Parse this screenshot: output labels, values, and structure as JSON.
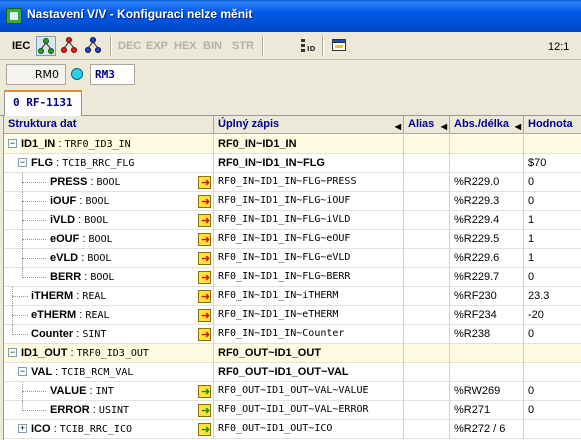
{
  "window": {
    "title": "Nastavení V/V - Konfiguraci nelze měnit"
  },
  "toolbar": {
    "iec_label": "IEC",
    "dec_label": "DEC",
    "exp_label": "EXP",
    "hex_label": "HEX",
    "bin_label": "BIN",
    "str_label": "STR",
    "clock": "12:1"
  },
  "rm": {
    "rm0_label": "RM0",
    "rm3_label": "RM3",
    "indicator_color": "#22d5e8"
  },
  "tab": {
    "label": "0 RF-1131"
  },
  "grid": {
    "headers": {
      "struktura": "Struktura dat",
      "uplny": "Úplný zápis",
      "alias": "Alias",
      "abs": "Abs./délka",
      "hodnota": "Hodnota"
    },
    "rows": [
      {
        "name": "ID1_IN",
        "type": "TRF0_ID3_IN",
        "full": "RF0_IN~ID1_IN",
        "abs": "",
        "val": ""
      },
      {
        "name": "FLG",
        "type": "TCIB_RRC_FLG",
        "full": "RF0_IN~ID1_IN~FLG",
        "abs": "",
        "val": "$70"
      },
      {
        "name": "PRESS",
        "type": "BOOL",
        "full": "RF0_IN~ID1_IN~FLG~PRESS",
        "abs": "%R229.0",
        "val": "0"
      },
      {
        "name": "iOUF",
        "type": "BOOL",
        "full": "RF0_IN~ID1_IN~FLG~iOUF",
        "abs": "%R229.3",
        "val": "0"
      },
      {
        "name": "iVLD",
        "type": "BOOL",
        "full": "RF0_IN~ID1_IN~FLG~iVLD",
        "abs": "%R229.4",
        "val": "1"
      },
      {
        "name": "eOUF",
        "type": "BOOL",
        "full": "RF0_IN~ID1_IN~FLG~eOUF",
        "abs": "%R229.5",
        "val": "1"
      },
      {
        "name": "eVLD",
        "type": "BOOL",
        "full": "RF0_IN~ID1_IN~FLG~eVLD",
        "abs": "%R229.6",
        "val": "1"
      },
      {
        "name": "BERR",
        "type": "BOOL",
        "full": "RF0_IN~ID1_IN~FLG~BERR",
        "abs": "%R229.7",
        "val": "0"
      },
      {
        "name": "iTHERM",
        "type": "REAL",
        "full": "RF0_IN~ID1_IN~iTHERM",
        "abs": "%RF230",
        "val": "23.3"
      },
      {
        "name": "eTHERM",
        "type": "REAL",
        "full": "RF0_IN~ID1_IN~eTHERM",
        "abs": "%RF234",
        "val": "-20"
      },
      {
        "name": "Counter",
        "type": "SINT",
        "full": "RF0_IN~ID1_IN~Counter",
        "abs": "%R238",
        "val": "0"
      },
      {
        "name": "ID1_OUT",
        "type": "TRF0_ID3_OUT",
        "full": "RF0_OUT~ID1_OUT",
        "abs": "",
        "val": ""
      },
      {
        "name": "VAL",
        "type": "TCIB_RCM_VAL",
        "full": "RF0_OUT~ID1_OUT~VAL",
        "abs": "",
        "val": ""
      },
      {
        "name": "VALUE",
        "type": "INT",
        "full": "RF0_OUT~ID1_OUT~VAL~VALUE",
        "abs": "%RW269",
        "val": "0"
      },
      {
        "name": "ERROR",
        "type": "USINT",
        "full": "RF0_OUT~ID1_OUT~VAL~ERROR",
        "abs": "%R271",
        "val": "0"
      },
      {
        "name": "ICO",
        "type": "TCIB_RRC_ICO",
        "full": "RF0_OUT~ID1_OUT~ICO",
        "abs": "%R272 / 6",
        "val": ""
      }
    ]
  }
}
